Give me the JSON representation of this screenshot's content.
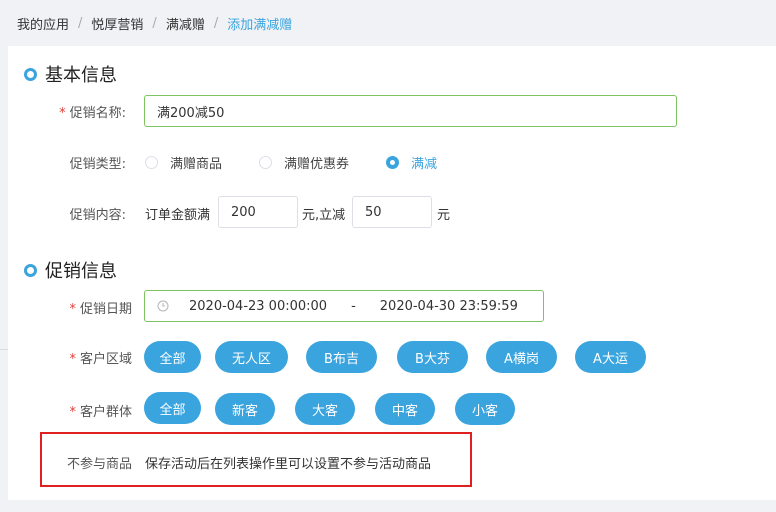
{
  "breadcrumb": {
    "items": [
      "我的应用",
      "悦厚营销",
      "满减赠"
    ],
    "current": "添加满减赠",
    "separator": "/"
  },
  "basic_info": {
    "title": "基本信息",
    "name_label": "促销名称:",
    "name_value": "满200减50",
    "type_label": "促销类型:",
    "type_options": [
      "满赠商品",
      "满赠优惠券",
      "满减"
    ],
    "type_selected": "满减",
    "content_label": "促销内容:",
    "content_prefix": "订单金额满",
    "threshold_value": "200",
    "content_middle": "元,立减",
    "discount_value": "50",
    "content_suffix": "元"
  },
  "promo_info": {
    "title": "促销信息",
    "date_label": "促销日期",
    "date_start": "2020-04-23 00:00:00",
    "date_separator": "-",
    "date_end": "2020-04-30 23:59:59",
    "region_label": "客户区域",
    "regions": [
      "全部",
      "无人区",
      "B布吉",
      "B大芬",
      "A横岗",
      "A大运"
    ],
    "group_label": "客户群体",
    "groups": [
      "全部",
      "新客",
      "大客",
      "中客",
      "小客"
    ],
    "excluded_label": "不参与商品",
    "excluded_text": "保存活动后在列表操作里可以设置不参与活动商品"
  },
  "colors": {
    "accent": "#3aa4df",
    "valid_border": "#7dc361",
    "required": "#e0403a",
    "highlight_box": "#e02020"
  },
  "icons": {
    "section_marker": "ring-dot-icon",
    "date_prefix": "clock-icon"
  }
}
